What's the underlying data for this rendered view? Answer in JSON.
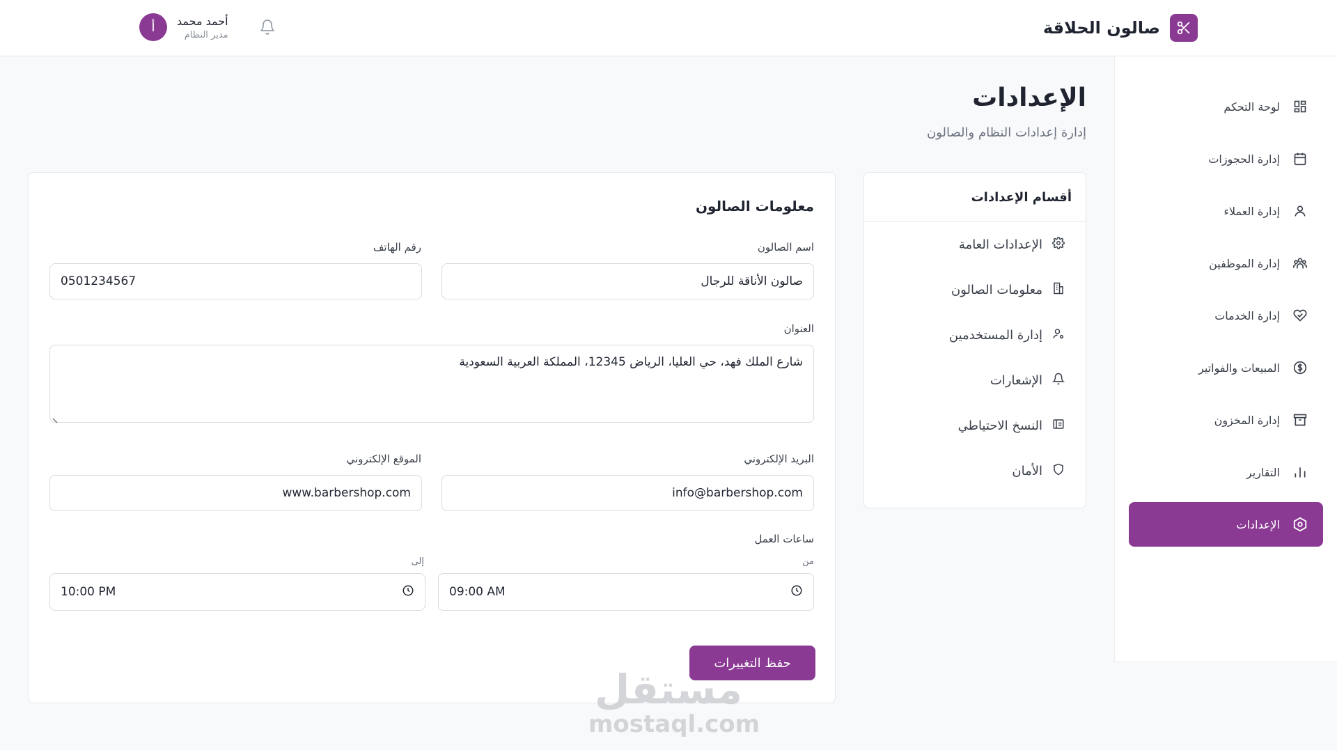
{
  "header": {
    "brand_title": "صالون الحلاقة",
    "user_name": "أحمد محمد",
    "user_role": "مدير النظام",
    "avatar_initial": "أ"
  },
  "sidebar": {
    "items": [
      {
        "label": "لوحة التحكم",
        "icon": "dashboard-icon"
      },
      {
        "label": "إدارة الحجوزات",
        "icon": "calendar-icon"
      },
      {
        "label": "إدارة العملاء",
        "icon": "user-icon"
      },
      {
        "label": "إدارة الموظفين",
        "icon": "users-icon"
      },
      {
        "label": "إدارة الخدمات",
        "icon": "heart-hand-icon"
      },
      {
        "label": "المبيعات والفواتير",
        "icon": "dollar-icon"
      },
      {
        "label": "إدارة المخزون",
        "icon": "archive-icon"
      },
      {
        "label": "التقارير",
        "icon": "bar-chart-icon"
      },
      {
        "label": "الإعدادات",
        "icon": "settings-icon",
        "active": true
      }
    ]
  },
  "page": {
    "title": "الإعدادات",
    "subtitle": "إدارة إعدادات النظام والصالون"
  },
  "sections": {
    "title": "أقسام الإعدادات",
    "items": [
      {
        "label": "الإعدادات العامة",
        "icon": "gear-icon"
      },
      {
        "label": "معلومات الصالون",
        "icon": "building-icon"
      },
      {
        "label": "إدارة المستخدمين",
        "icon": "user-cog-icon"
      },
      {
        "label": "الإشعارات",
        "icon": "bell-icon"
      },
      {
        "label": "النسخ الاحتياطي",
        "icon": "database-icon"
      },
      {
        "label": "الأمان",
        "icon": "shield-icon"
      }
    ]
  },
  "form": {
    "title": "معلومات الصالون",
    "salon_name_label": "اسم الصالون",
    "salon_name_value": "صالون الأناقة للرجال",
    "phone_label": "رقم الهاتف",
    "phone_value": "0501234567",
    "address_label": "العنوان",
    "address_value": "شارع الملك فهد، حي العليا، الرياض 12345، المملكة العربية السعودية",
    "email_label": "البريد الإلكتروني",
    "email_value": "info@barbershop.com",
    "website_label": "الموقع الإلكتروني",
    "website_value": "www.barbershop.com",
    "hours_label": "ساعات العمل",
    "from_label": "من",
    "from_value": "09:00 AM",
    "to_label": "إلى",
    "to_value": "10:00 PM",
    "save_label": "حفظ التغييرات"
  },
  "watermark": {
    "ar": "مستقل",
    "en": "mostaql.com"
  },
  "colors": {
    "accent": "#8b3a94",
    "background": "#f8f9fb",
    "border": "#e6e8ec"
  }
}
